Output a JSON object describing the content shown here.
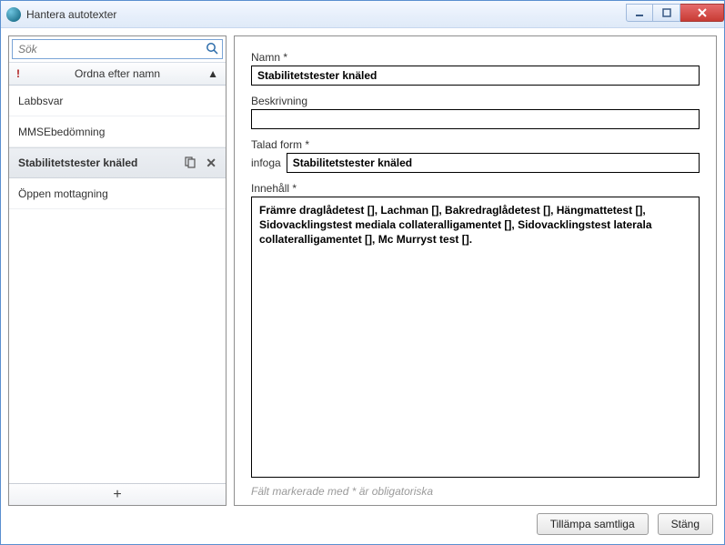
{
  "window": {
    "title": "Hantera autotexter"
  },
  "left": {
    "search_placeholder": "Sök",
    "sort_label": "Ordna efter namn",
    "items": [
      {
        "label": "Labbsvar",
        "selected": false
      },
      {
        "label": "MMSEbedömning",
        "selected": false
      },
      {
        "label": "Stabilitetstester knäled",
        "selected": true
      },
      {
        "label": "Öppen mottagning",
        "selected": false
      }
    ]
  },
  "form": {
    "name_label": "Namn *",
    "name_value": "Stabilitetstester knäled",
    "desc_label": "Beskrivning",
    "desc_value": "",
    "spoken_label": "Talad form *",
    "spoken_prefix": "infoga",
    "spoken_value": "Stabilitetstester knäled",
    "content_label": "Innehåll *",
    "content_value": "Främre draglådetest [], Lachman [], Bakredraglådetest [], Hängmattetest [], Sidovacklingstest mediala collateralligamentet [], Sidovacklingstest laterala collateralligamentet [], Mc Murryst test [].",
    "required_note": "Fält markerade med * är obligatoriska"
  },
  "footer": {
    "apply_label": "Tillämpa samtliga",
    "close_label": "Stäng"
  }
}
